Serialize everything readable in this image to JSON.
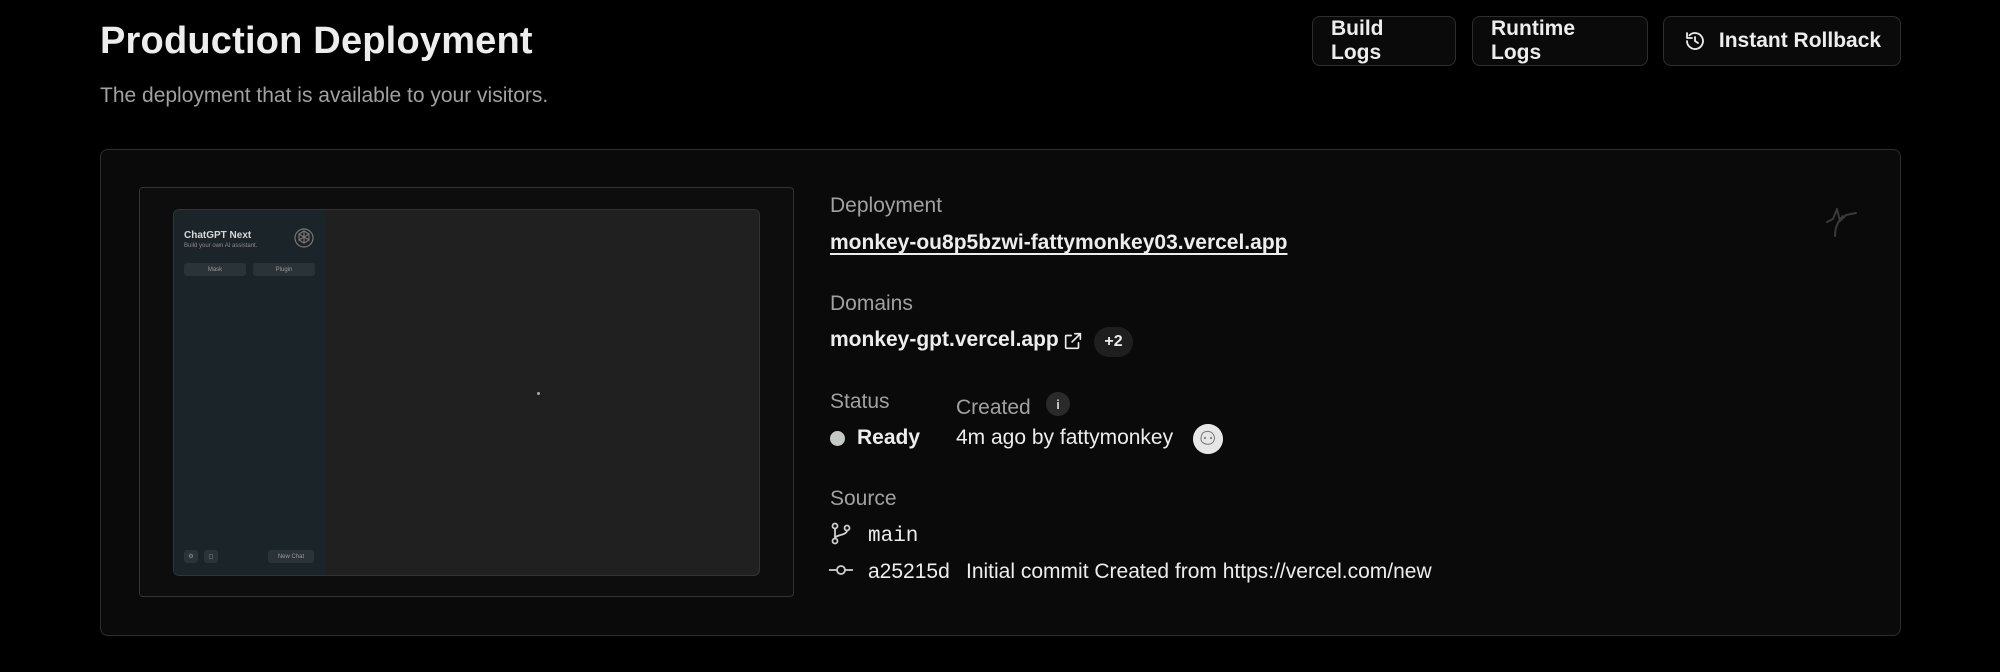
{
  "header": {
    "title": "Production Deployment",
    "subtitle": "The deployment that is available to your visitors."
  },
  "actions": {
    "build_logs": "Build Logs",
    "runtime_logs": "Runtime Logs",
    "instant_rollback": "Instant Rollback"
  },
  "preview": {
    "app_title": "ChatGPT Next",
    "app_subtitle": "Build your own AI assistant.",
    "mask_label": "Mask",
    "plugin_label": "Plugin",
    "new_chat_label": "New Chat"
  },
  "deployment": {
    "label": "Deployment",
    "url": "monkey-ou8p5bzwi-fattymonkey03.vercel.app"
  },
  "domains": {
    "label": "Domains",
    "primary": "monkey-gpt.vercel.app",
    "extra_count": "+2"
  },
  "status": {
    "label": "Status",
    "value": "Ready",
    "dot_color": "#c4c9c5"
  },
  "created": {
    "label": "Created",
    "info_glyph": "i",
    "value": "4m ago by fattymonkey"
  },
  "source": {
    "label": "Source",
    "branch": "main",
    "commit_hash": "a25215d",
    "commit_message": "Initial commit Created from https://vercel.com/new"
  },
  "icons": {
    "rollback": "rollback-icon",
    "external_link": "external-link-icon",
    "branch": "git-branch-icon",
    "commit": "git-commit-icon",
    "activity": "activity-icon"
  }
}
